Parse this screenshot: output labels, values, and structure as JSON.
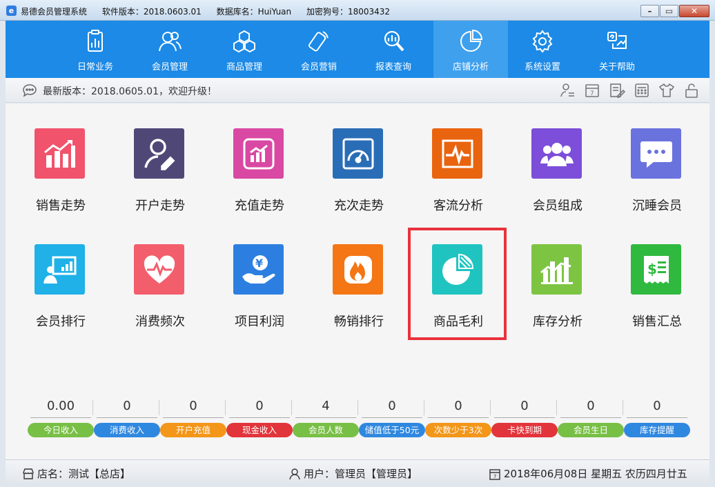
{
  "window": {
    "app_name": "易德会员管理系统",
    "version": "软件版本：2018.0603.01",
    "database": "数据库名：HuiYuan",
    "dongle": "加密狗号：18003432"
  },
  "nav": [
    {
      "label": "日常业务",
      "icon": "clipboard-chart-icon"
    },
    {
      "label": "会员管理",
      "icon": "members-icon"
    },
    {
      "label": "商品管理",
      "icon": "cubes-icon"
    },
    {
      "label": "会员营销",
      "icon": "phone-icon"
    },
    {
      "label": "报表查询",
      "icon": "search-chart-icon"
    },
    {
      "label": "店铺分析",
      "icon": "pie-chart-icon",
      "active": true
    },
    {
      "label": "系统设置",
      "icon": "gear-icon"
    },
    {
      "label": "关于帮助",
      "icon": "help-icon"
    }
  ],
  "notice": {
    "text": "最新版本：2018.0605.01，欢迎升级！"
  },
  "tiles": [
    {
      "label": "销售走势",
      "color": "#f0536b"
    },
    {
      "label": "开户走势",
      "color": "#4f4877"
    },
    {
      "label": "充值走势",
      "color": "#d949a3"
    },
    {
      "label": "充次走势",
      "color": "#2a6db7"
    },
    {
      "label": "客流分析",
      "color": "#e9640f"
    },
    {
      "label": "会员组成",
      "color": "#7c4ed9"
    },
    {
      "label": "沉睡会员",
      "color": "#6a72de"
    },
    {
      "label": "会员排行",
      "color": "#1fb1e8"
    },
    {
      "label": "消费频次",
      "color": "#f25e6c"
    },
    {
      "label": "项目利润",
      "color": "#2c7fe0"
    },
    {
      "label": "畅销排行",
      "color": "#f47614"
    },
    {
      "label": "商品毛利",
      "color": "#1fc4c0"
    },
    {
      "label": "库存分析",
      "color": "#7cc442"
    },
    {
      "label": "销售汇总",
      "color": "#2fb93f"
    }
  ],
  "stats": [
    {
      "value": "0.00",
      "label": "今日收入",
      "color": "#78bf45"
    },
    {
      "value": "0",
      "label": "消费收入",
      "color": "#2f88e0"
    },
    {
      "value": "0",
      "label": "开户充值",
      "color": "#f39619"
    },
    {
      "value": "0",
      "label": "现金收入",
      "color": "#e2343b"
    },
    {
      "value": "4",
      "label": "会员人数",
      "color": "#78bf45"
    },
    {
      "value": "0",
      "label": "储值低于50元",
      "color": "#2f88e0"
    },
    {
      "value": "0",
      "label": "次数少于3次",
      "color": "#f39619"
    },
    {
      "value": "0",
      "label": "卡快到期",
      "color": "#e2343b"
    },
    {
      "value": "0",
      "label": "会员生日",
      "color": "#78bf45"
    },
    {
      "value": "0",
      "label": "库存提醒",
      "color": "#2f88e0"
    }
  ],
  "status": {
    "store": "店名：测试【总店】",
    "user": "用户：管理员【管理员】",
    "date": "2018年06月08日 星期五 农历四月廿五"
  }
}
